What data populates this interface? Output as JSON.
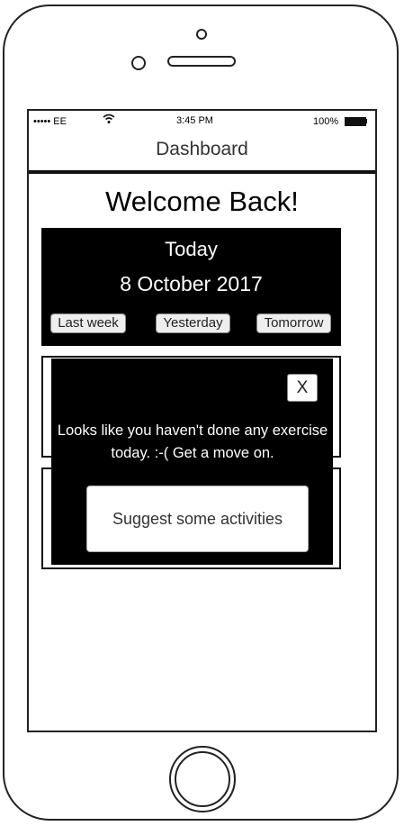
{
  "status_bar": {
    "carrier": "••••• EE",
    "wifi_icon": "wifi-icon",
    "time": "3:45 PM",
    "battery": "100%",
    "battery_icon": "battery-icon"
  },
  "nav": {
    "title": "Dashboard"
  },
  "main": {
    "welcome": "Welcome Back!",
    "today_card": {
      "label": "Today",
      "date": "8 October 2017",
      "buttons": [
        "Last week",
        "Yesterday",
        "Tomorrow"
      ]
    }
  },
  "modal": {
    "close_label": "X",
    "message": "Looks like you haven't done any exercise today. :-( Get a move on.",
    "action_label": "Suggest some activities"
  },
  "colors": {
    "card_background": "#000000",
    "button_background": "#eeeeee",
    "text_on_dark": "#ffffff"
  }
}
